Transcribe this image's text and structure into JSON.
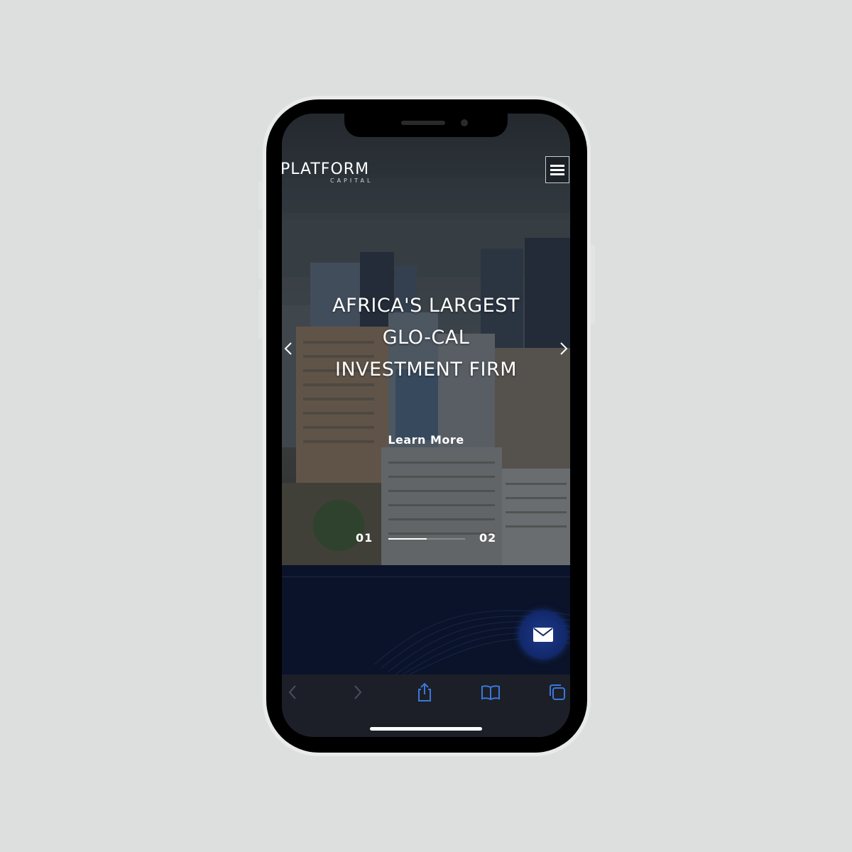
{
  "logo": {
    "main": "PLATFORM",
    "sub": "CAPITAL"
  },
  "hero": {
    "title_lines": [
      "AFRICA'S LARGEST",
      "GLO-CAL",
      "INVESTMENT FIRM"
    ],
    "cta_label": "Learn More"
  },
  "pager": {
    "current": "01",
    "next": "02",
    "progress": 0.5
  },
  "icons": {
    "menu": "hamburger-icon",
    "prev": "chevron-left-icon",
    "next": "chevron-right-icon",
    "contact": "mail-icon",
    "share": "share-icon",
    "bookmarks": "book-icon",
    "tabs": "tabs-icon"
  },
  "colors": {
    "accent": "#1d3a8a",
    "safari_icon": "#3a78d8",
    "dark_bg": "#0a1329"
  }
}
